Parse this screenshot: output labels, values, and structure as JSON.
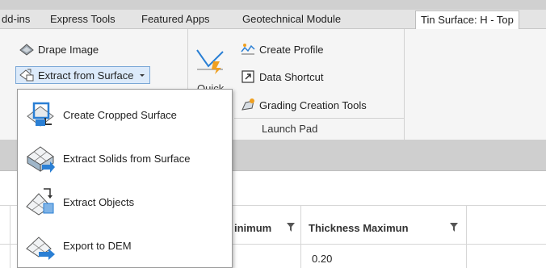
{
  "tabs": [
    {
      "label": "dd-ins"
    },
    {
      "label": "Express Tools"
    },
    {
      "label": "Featured Apps"
    },
    {
      "label": "Geotechnical Module"
    },
    {
      "label": "Tin Surface: H - Top"
    }
  ],
  "ribbon": {
    "drape_image": "Drape Image",
    "extract_from_surface": "Extract from Surface",
    "quick_label": "Quick",
    "create_profile": "Create Profile",
    "data_shortcut": "Data Shortcut",
    "grading_creation_tools": "Grading Creation Tools",
    "launch_pad": "Launch Pad"
  },
  "dropdown": {
    "items": [
      {
        "label": "Create Cropped Surface"
      },
      {
        "label": "Extract Solids from Surface"
      },
      {
        "label": "Extract Objects"
      },
      {
        "label": "Export to DEM"
      }
    ]
  },
  "table": {
    "columns": [
      "inimum",
      "Thickness Maximun"
    ],
    "rows": [
      {
        "thickness_max": "0.20"
      }
    ]
  },
  "colors": {
    "accent_blue": "#2a7fd4",
    "pressed_bg": "#dceafa",
    "pressed_border": "#7aa7d6"
  }
}
